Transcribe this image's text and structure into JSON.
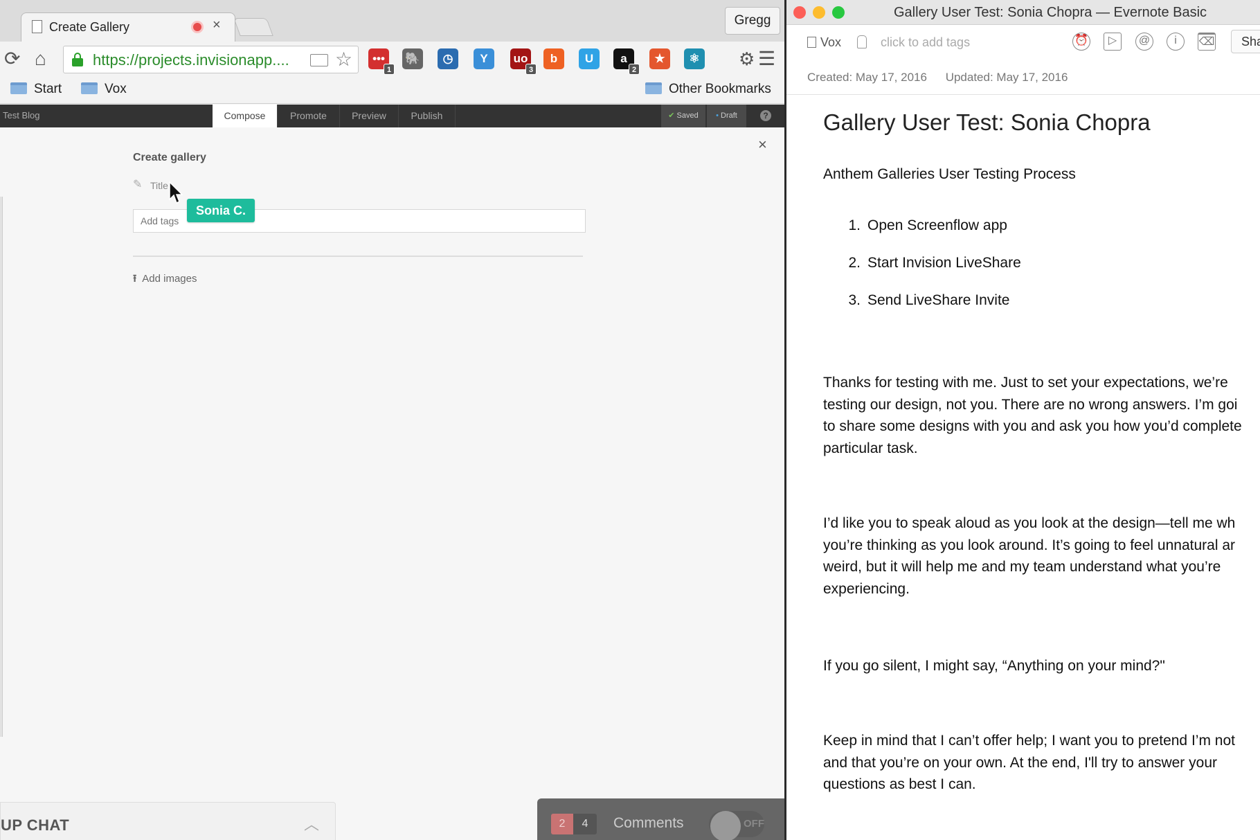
{
  "chrome": {
    "tab_title": "Create Gallery",
    "tab_close": "×",
    "profile": "Gregg",
    "url_scheme_host": "https://projects.invisionapp....",
    "bookmarks": {
      "start": "Start",
      "vox": "Vox",
      "other": "Other Bookmarks"
    },
    "extensions": [
      {
        "name": "lastpass",
        "glyph": "•••",
        "badge": "1",
        "color": "#d32f2f"
      },
      {
        "name": "evernote",
        "glyph": "🐘",
        "badge": "",
        "color": "#666666"
      },
      {
        "name": "clock",
        "glyph": "◷",
        "badge": "",
        "color": "#2b6cb0"
      },
      {
        "name": "yoast",
        "glyph": "Y",
        "badge": "",
        "color": "#3a8fd8"
      },
      {
        "name": "ublock",
        "glyph": "uo",
        "badge": "3",
        "color": "#a31515"
      },
      {
        "name": "bitly",
        "glyph": "b",
        "badge": "",
        "color": "#ee6123"
      },
      {
        "name": "u-ext",
        "glyph": "U",
        "badge": "",
        "color": "#2fa3e6"
      },
      {
        "name": "amazon",
        "glyph": "a",
        "badge": "2",
        "color": "#111111"
      },
      {
        "name": "bookmark-ext",
        "glyph": "★",
        "badge": "",
        "color": "#e4572e"
      },
      {
        "name": "molecule",
        "glyph": "⚛",
        "badge": "",
        "color": "#1f8fb0"
      }
    ]
  },
  "app": {
    "blog": "Test Blog",
    "tabs": [
      "Compose",
      "Promote",
      "Preview",
      "Publish"
    ],
    "saved": "Saved",
    "draft": "Draft",
    "heading": "Create gallery",
    "close": "×",
    "title_placeholder": "Title",
    "tags_placeholder": "Add tags",
    "collaborator": "Sonia C.",
    "add_images": "Add images",
    "group_chat": "UP CHAT",
    "comments_unread": "2",
    "comments_total": "4",
    "comments_label": "Comments",
    "comments_toggle": "OFF"
  },
  "evernote": {
    "window_title": "Gallery User Test: Sonia Chopra — Evernote Basic",
    "notebook": "Vox",
    "tag_hint": "click to add tags",
    "share": "Sha",
    "created": "Created: May 17, 2016",
    "updated": "Updated: May 17, 2016",
    "note": {
      "title": "Gallery User Test: Sonia Chopra",
      "subtitle": "Anthem Galleries User Testing Process",
      "steps": [
        "Open Screenflow app",
        "Start Invision LiveShare",
        "Send LiveShare Invite"
      ],
      "paragraphs": [
        [
          "Thanks for testing with me. Just to set your expectations, we’re",
          "testing our design, not you. There are no wrong answers. I’m goi",
          "to share some designs with you and ask you how you’d complete",
          "particular task."
        ],
        [
          "I’d like you to speak aloud as you look at the design—tell me wh",
          "you’re thinking as you look around. It’s going to feel unnatural ar",
          "weird, but it will help me and my team understand what you’re",
          "experiencing."
        ],
        [
          "If you go silent, I might say, “Anything on your mind?\""
        ],
        [
          "Keep in mind that I can’t offer help; I want you to pretend I’m not",
          "and that you’re on your own. At the end, I'll try to answer your",
          "questions as best I can."
        ]
      ]
    }
  },
  "colors": {
    "accent_teal": "#1ebc9c",
    "url_green": "#2b8c2b",
    "app_header": "#333333",
    "traffic_red": "#fc5f57",
    "traffic_yellow": "#fdbc2e",
    "traffic_green": "#28c840"
  }
}
